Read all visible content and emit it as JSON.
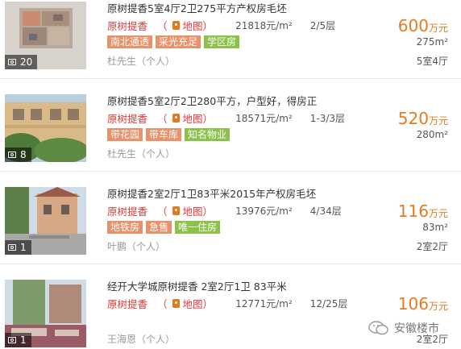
{
  "listings": [
    {
      "photo_count": "20",
      "title": "原树提香5室4厅2卫275平方产权房毛坯",
      "community": "原树提香",
      "map_label": "地图",
      "unit_price": "21818元/m²",
      "floor": "2/5层",
      "tags": [
        "南北通透",
        "采光充足",
        "学区房"
      ],
      "agent": "杜先生（个人）",
      "price": "600",
      "price_unit": "万元",
      "area": "275m²",
      "layout": "5室4厅"
    },
    {
      "photo_count": "8",
      "title": "原树提香5室2厅2卫280平方，户型好，得房正",
      "community": "原树提香",
      "map_label": "地图",
      "unit_price": "18571元/m²",
      "floor": "1-3/3层",
      "tags": [
        "带花园",
        "带车库",
        "知名物业"
      ],
      "agent": "杜先生（个人）",
      "price": "520",
      "price_unit": "万元",
      "area": "280m²",
      "layout": ""
    },
    {
      "photo_count": "1",
      "title": "原树提香2室2厅1卫83平米2015年产权房毛坯",
      "community": "原树提香",
      "map_label": "地图",
      "unit_price": "13976元/m²",
      "floor": "4/34层",
      "tags": [
        "地铁房",
        "急售",
        "唯一住房"
      ],
      "agent": "叶鹏（个人）",
      "price": "116",
      "price_unit": "万元",
      "area": "83m²",
      "layout": "2室2厅"
    },
    {
      "photo_count": "1",
      "title": "经开大学城原树提香 2室2厅1卫 83平米",
      "community": "原树提香",
      "map_label": "地图",
      "unit_price": "12771元/m²",
      "floor": "12/25层",
      "tags": [],
      "agent": "王海恩（个人）",
      "price": "106",
      "price_unit": "万元",
      "area": "",
      "layout": "2室2厅"
    }
  ],
  "watermark": "安徽楼市",
  "colors": {
    "price": "#e47b20",
    "community": "#e4393c",
    "tag_orange": "#e8916b",
    "tag_green": "#8bc34a"
  }
}
